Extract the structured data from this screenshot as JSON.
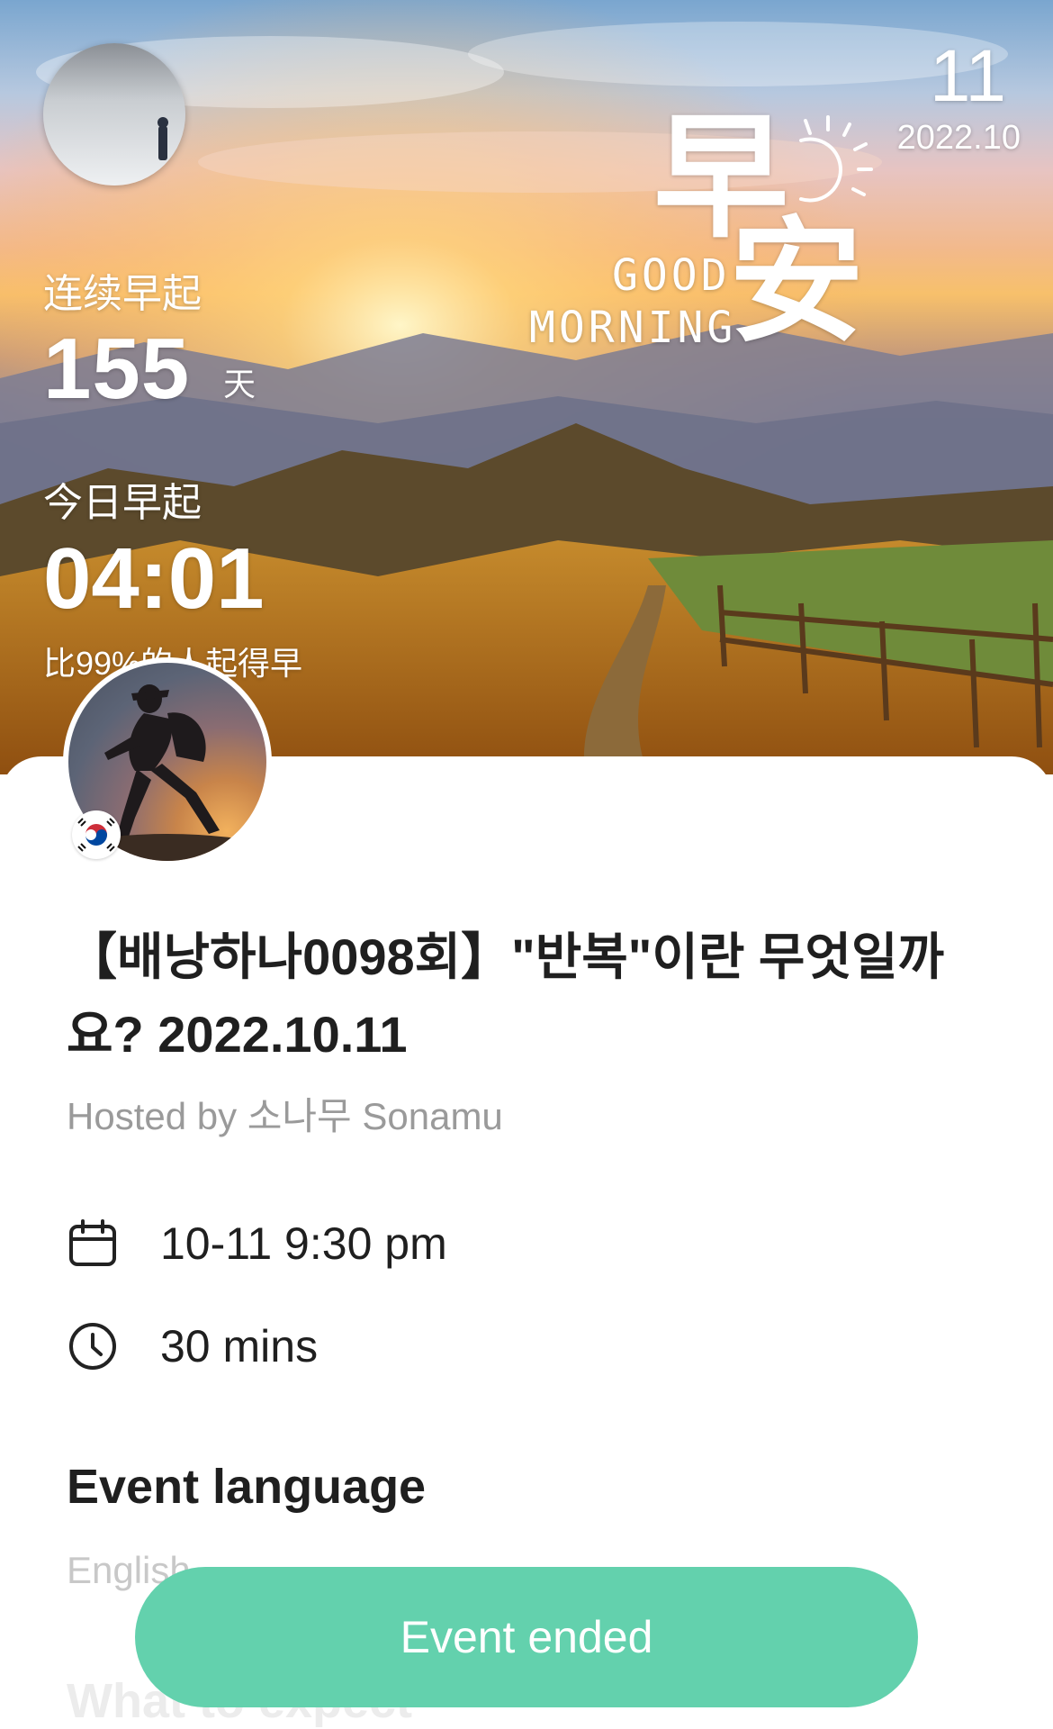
{
  "hero": {
    "streak_label": "连续早起",
    "streak_value": "155",
    "streak_unit": "天",
    "today_label": "今日早起",
    "today_time": "04:01",
    "compare_text": "比99%的人起得早",
    "day_number": "11",
    "year_month": "2022.10",
    "greeting_char_1": "早",
    "greeting_char_2": "安",
    "greeting_line_1": "GOOD",
    "greeting_line_2": "MORNING"
  },
  "event": {
    "title": "【배낭하나0098회】\"반복\"이란 무엇일까요? 2022.10.11",
    "hosted_by": "Hosted by 소나무 Sonamu",
    "date_time": "10-11 9:30 pm",
    "duration": "30 mins",
    "language_heading": "Event language",
    "language_value": "English",
    "next_heading": "What to expect",
    "button_label": "Event ended"
  },
  "colors": {
    "button": "#63d1ad",
    "title_text": "#1f1f1f",
    "muted_text": "#9a9a9a"
  },
  "icons": {
    "date": "calendar-icon",
    "duration": "clock-icon",
    "flag": "korea-flag-icon"
  }
}
